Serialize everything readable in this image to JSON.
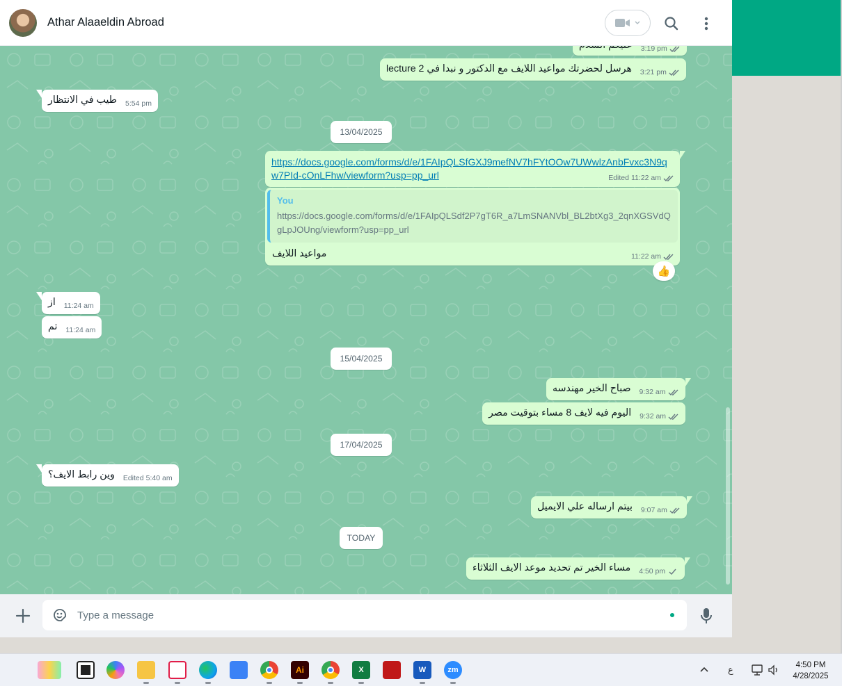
{
  "header": {
    "contact_name": "Athar Alaaeldin Abroad"
  },
  "messages": [
    {
      "id": "m1",
      "dir": "out",
      "text": "عليكم السلام",
      "time": "3:19 pm",
      "status": "read"
    },
    {
      "id": "m2",
      "dir": "out",
      "text": "هرسل لحضرتك مواعيد اللايف مع الدكتور و نبدا في lecture 2",
      "time": "3:21 pm",
      "status": "read"
    },
    {
      "id": "m3",
      "dir": "in",
      "text": "طيب في الانتظار",
      "time": "5:54 pm"
    },
    {
      "id": "m5",
      "dir": "out",
      "link": "https://docs.google.com/forms/d/e/1FAIpQLSfGXJ9mefNV7hFYtOOw7UWwlzAnbFvxc3N9qw7PId-cOnLFhw/viewform?usp=pp_url",
      "edited": "Edited",
      "time": "11:22 am",
      "status": "read"
    },
    {
      "id": "m6",
      "dir": "out",
      "quote_author": "You",
      "quote_text": "https://docs.google.com/forms/d/e/1FAIpQLSdf2P7gT6R_a7LmSNANVbl_BL2btXg3_2qnXGSVdQgLpJOUng/viewform?usp=pp_url",
      "text": "مواعيد اللايف",
      "time": "11:22 am",
      "status": "read",
      "reaction": "👍"
    },
    {
      "id": "m7",
      "dir": "in",
      "text": "از",
      "time": "11:24 am"
    },
    {
      "id": "m8",
      "dir": "in",
      "text": "تم",
      "time": "11:24 am"
    },
    {
      "id": "m10",
      "dir": "out",
      "text": "صباح الخير مهندسه",
      "time": "9:32 am",
      "status": "read"
    },
    {
      "id": "m11",
      "dir": "out",
      "text": "اليوم فيه لايف 8 مساء بتوقيت مصر",
      "time": "9:32 am",
      "status": "read"
    },
    {
      "id": "m13",
      "dir": "in",
      "text": "وين رابط الايف؟",
      "edited": "Edited",
      "time": "5:40 am"
    },
    {
      "id": "m14",
      "dir": "out",
      "text": "بيتم ارساله علي الايميل",
      "time": "9:07 am",
      "status": "read"
    },
    {
      "id": "m16",
      "dir": "out",
      "text": "مساء الخير تم تحديد موعد الايف الثلاثاء",
      "time": "4:50 pm",
      "status": "sent"
    }
  ],
  "dates": [
    "13/04/2025",
    "15/04/2025",
    "17/04/2025",
    "TODAY"
  ],
  "composer": {
    "placeholder": "Type a message"
  },
  "colors": {
    "accent": "#00a884",
    "chat_bg": "#84c7a8",
    "outgoing_bubble": "#d9fdd3",
    "incoming_bubble": "#ffffff",
    "read_ticks": "#667781"
  },
  "taskbar": {
    "apps": [
      "widgets-icon",
      "task-view-icon",
      "copilot-icon",
      "file-explorer-icon",
      "snipping-tool-icon",
      "edge-icon",
      "notepad-icon",
      "chrome-icon",
      "illustrator-icon",
      "chrome-profile-icon",
      "excel-icon",
      "mcafee-icon",
      "word-icon",
      "zoom-icon"
    ],
    "illustrator_label": "Ai",
    "excel_label": "X",
    "word_label": "W",
    "zoom_label": "zm",
    "tray_lang": "ع",
    "clock_time": "4:50 PM",
    "clock_date": "4/28/2025"
  }
}
